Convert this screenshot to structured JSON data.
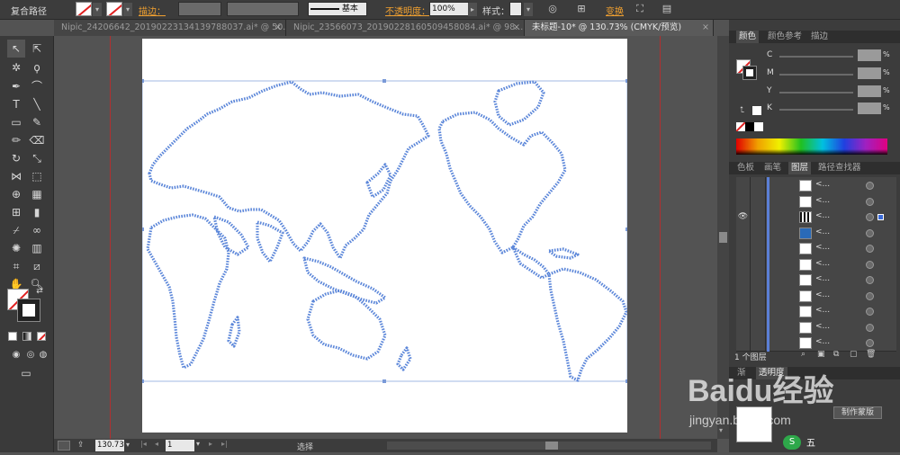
{
  "control_bar": {
    "object_type": "复合路径",
    "stroke_label": "描边：",
    "brush_value": "基本",
    "opacity_label": "不透明度：",
    "opacity_value": "100%",
    "style_label": "样式：",
    "transform_label": "变换"
  },
  "tabs": [
    {
      "label": "Nipic_24206642_20190223134139788037.ai* @ 50...",
      "active": false
    },
    {
      "label": "Nipic_23566073_20190228160509458084.ai* @ 98...",
      "active": false
    },
    {
      "label": "未标题-10* @ 130.73% (CMYK/预览)",
      "active": true
    }
  ],
  "color_panel": {
    "tabs": [
      "颜色",
      "颜色参考",
      "描边"
    ],
    "channels": [
      {
        "label": "C",
        "pct": "%"
      },
      {
        "label": "M",
        "pct": "%"
      },
      {
        "label": "Y",
        "pct": "%"
      },
      {
        "label": "K",
        "pct": "%"
      }
    ]
  },
  "layers_panel": {
    "tabs": [
      "色板",
      "画笔",
      "图层",
      "路径查找器"
    ],
    "row_label": "<...",
    "row_count": 11,
    "footer": "1 个图层"
  },
  "status_bar": {
    "zoom": "130.73",
    "page": "1",
    "mode": "选择"
  },
  "bottom_panel": {
    "make_mask": "制作蒙版",
    "tab1": "渐",
    "tab2": "透明度"
  },
  "watermark": {
    "brand": "Baidu经验",
    "url": "jingyan.baidu.com",
    "ime": "五"
  },
  "colors": {
    "map_stroke": "#5b86d9",
    "guide": "#b03030",
    "accent": "#f0a030"
  }
}
